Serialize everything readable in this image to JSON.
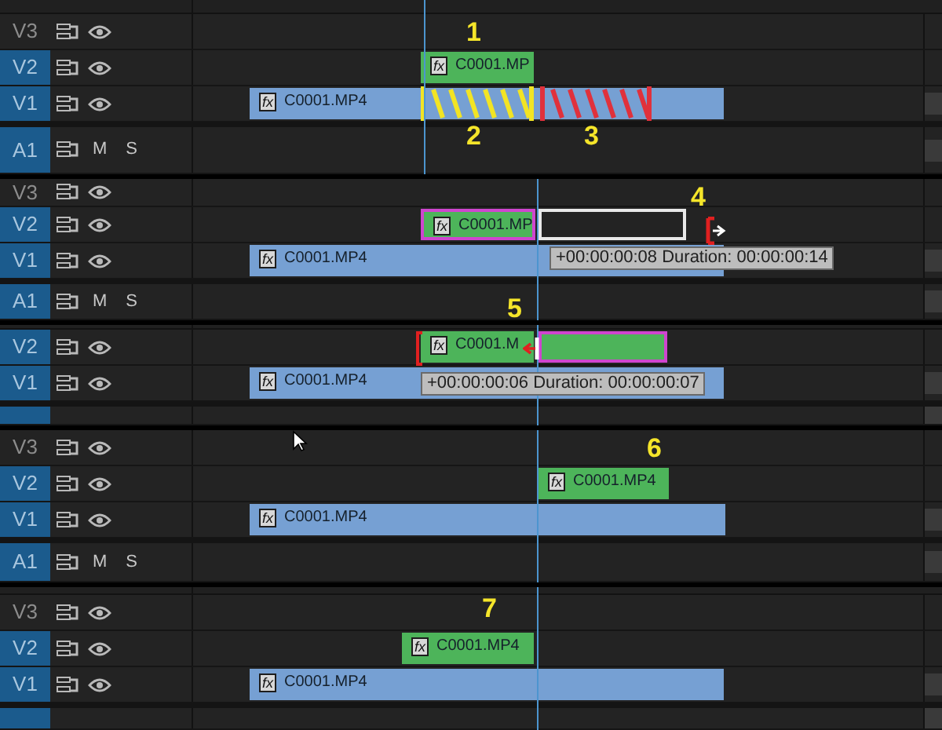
{
  "panels": [
    {
      "tracks": [
        {
          "label": "V3",
          "selected": false,
          "kind": "video"
        },
        {
          "label": "V2",
          "selected": true,
          "kind": "video",
          "clips": [
            {
              "kind": "clip",
              "badge": "fx",
              "name": "C0001.MP",
              "selected": false
            }
          ]
        },
        {
          "label": "V1",
          "selected": true,
          "kind": "video",
          "clips": [
            {
              "kind": "clip",
              "badge": "fx",
              "name": "C0001.MP4",
              "selected": false
            },
            {
              "kind": "hatch",
              "color": "#f2e424"
            },
            {
              "kind": "hatch",
              "color": "#e0313c"
            }
          ]
        },
        {
          "label": "A1",
          "selected": true,
          "kind": "audio",
          "toggles": [
            "M",
            "S"
          ]
        }
      ],
      "callouts": [
        "1",
        "2",
        "3"
      ]
    },
    {
      "tracks": [
        {
          "label": "V3",
          "selected": false,
          "kind": "video"
        },
        {
          "label": "V2",
          "selected": true,
          "kind": "video",
          "clips": [
            {
              "kind": "clip",
              "badge": "fx",
              "name": "C0001.MP",
              "selected": true
            },
            {
              "kind": "ghost"
            }
          ]
        },
        {
          "label": "V1",
          "selected": true,
          "kind": "video",
          "clips": [
            {
              "kind": "clip",
              "badge": "fx",
              "name": "C0001.MP4",
              "selected": false
            }
          ]
        },
        {
          "label": "A1",
          "selected": true,
          "kind": "audio",
          "toggles": [
            "M",
            "S"
          ]
        }
      ],
      "callouts": [
        "4",
        "5"
      ],
      "tooltip": "+00:00:00:08 Duration: 00:00:00:14"
    },
    {
      "tracks": [
        {
          "label": "V2",
          "selected": true,
          "kind": "video",
          "clips": [
            {
              "kind": "clip",
              "badge": "fx",
              "name": "C0001.M",
              "selected": false
            },
            {
              "kind": "extension",
              "selected": true
            }
          ]
        },
        {
          "label": "V1",
          "selected": true,
          "kind": "video",
          "clips": [
            {
              "kind": "clip",
              "badge": "fx",
              "name": "C0001.MP4",
              "selected": false
            }
          ]
        },
        {
          "selected": true,
          "kind": "audio"
        }
      ],
      "tooltip": "+00:00:00:06 Duration: 00:00:00:07"
    },
    {
      "tracks": [
        {
          "label": "V3",
          "selected": false,
          "kind": "video"
        },
        {
          "label": "V2",
          "selected": true,
          "kind": "video",
          "clips": [
            {
              "kind": "clip",
              "badge": "fx",
              "name": "C0001.MP4",
              "selected": false
            }
          ]
        },
        {
          "label": "V1",
          "selected": true,
          "kind": "video",
          "clips": [
            {
              "kind": "clip",
              "badge": "fx",
              "name": "C0001.MP4",
              "selected": false
            }
          ]
        },
        {
          "label": "A1",
          "selected": true,
          "kind": "audio",
          "toggles": [
            "M",
            "S"
          ]
        }
      ],
      "callouts": [
        "6"
      ]
    },
    {
      "tracks": [
        {
          "label": "V3",
          "selected": false,
          "kind": "video"
        },
        {
          "label": "V2",
          "selected": true,
          "kind": "video",
          "clips": [
            {
              "kind": "clip",
              "badge": "fx",
              "name": "C0001.MP4",
              "selected": false
            }
          ]
        },
        {
          "label": "V1",
          "selected": true,
          "kind": "video",
          "clips": [
            {
              "kind": "clip",
              "badge": "fx",
              "name": "C0001.MP4",
              "selected": false
            }
          ]
        },
        {
          "selected": true,
          "kind": "audio"
        }
      ],
      "callouts": [
        "7"
      ]
    }
  ]
}
